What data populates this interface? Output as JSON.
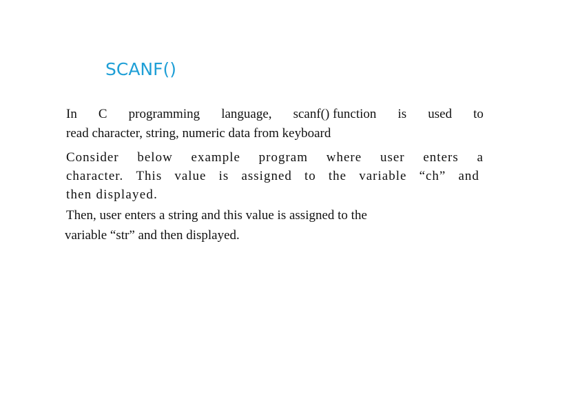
{
  "slide": {
    "title": "SCANF()",
    "title_color": "#1f9fd6",
    "paragraphs": [
      {
        "lines": [
          [
            "In",
            "C",
            "programming",
            "language,",
            "scanf() function",
            "is",
            "used",
            "to"
          ],
          "read character, string, numeric data from keyboard"
        ]
      },
      {
        "lines": [
          [
            "Consider",
            "below",
            "example",
            "program",
            "where",
            "user",
            "enters",
            "a"
          ],
          [
            "character.",
            "This",
            "value",
            "is",
            "assigned",
            "to",
            "the",
            "variable",
            "“ch”",
            "and"
          ],
          "then displayed.",
          "Then, user enters a string and this value is assigned to the",
          "variable “str” and then displayed."
        ]
      }
    ]
  }
}
